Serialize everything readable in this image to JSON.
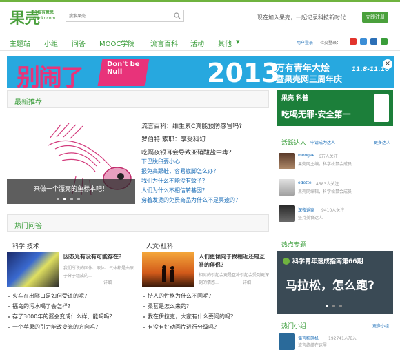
{
  "header": {
    "logo_cn": "果壳",
    "logo_small": "科技有意思",
    "logo_url": "Guokr.com",
    "search_placeholder": "搜索果壳",
    "join_text": "现在加入果壳，一起记录科技新时代",
    "join_button": "立即注册"
  },
  "nav": {
    "items": [
      "主题站",
      "小组",
      "问答",
      "MOOC学院",
      "流言百科",
      "活动",
      "其他"
    ],
    "login": "用户登录",
    "social_login": "社交登录："
  },
  "banner": {
    "big_text": "别闹了",
    "dont_be_null": "Don't be Null",
    "year": "2013",
    "line1": "万有青年大烩",
    "line2": "暨果壳网三周年庆",
    "dates": "11.8-11.10",
    "close": "×"
  },
  "latest": {
    "title": "最新推荐",
    "caption": "来做一个漂亮的鱼标本吧！",
    "headlines": [
      "流言百科：维生素C真能预防感冒吗?",
      "罗伯特·索耶：享受科幻",
      "吃隔夜银耳会导致亚硝酸盐中毒？"
    ],
    "links": [
      "下巴脱臼要小心",
      "报免高跟鞋，容易崴脚怎么办？",
      "我们为什么不能没有蚊子？",
      "人们为什么不相信转基因？",
      "穿着发烫的免费商品为什么不是冥途的？"
    ]
  },
  "hotqa": {
    "title": "热门问答",
    "science": {
      "label": "科学·技术",
      "q_title": "因态光有没有可能存在？",
      "q_desc": "我们所说的固体、液体、气体都是由原子分子组成的…",
      "detail": "详细",
      "list": [
        "火车在出隧口是如何受道的呢?",
        "福岛的污水喝了会怎样?",
        "存了3000年的酱会变成什么样、能喝吗？",
        "一个苹果的引力能改变光的方向吗？"
      ]
    },
    "humanities": {
      "label": "人文·社科",
      "q_title": "人们更倾向于找相近还是互补的伴侣？",
      "q_desc": "相似的引起会更是互补引起会受到更深刻的情感…",
      "detail": "详细",
      "list": [
        "持人的性格为什么不同呢？",
        "桑葚是怎么来的?",
        "我在伊拉克，大家有什么要问的吗？",
        "有没有好动画片进行分级吗？"
      ]
    }
  },
  "sidebar": {
    "ad_text": "吃喝无罪·安全第一",
    "ad_brand": "果壳 科普",
    "active_users_title": "活跃达人",
    "apply_link": "申请成为达人",
    "more": "更多达人",
    "users": [
      {
        "name": "moogee",
        "info": "6万人关注",
        "desc": "果壳网主编，科学松鼠会成员"
      },
      {
        "name": "odette",
        "info": "4583人关注",
        "desc": "果壳网编辑，科学松鼠会成员"
      },
      {
        "name": "深夜返家",
        "info": "9410人关注",
        "desc": "坚持美食达人"
      }
    ],
    "hot_topics_title": "热点专题",
    "hot_topic_headline": "科学青年速成指南第66期",
    "hot_topic_sub": "马拉松，怎么跑?",
    "hot_groups_title": "热门小组",
    "more_groups": "更多小组",
    "group": {
      "name": "谣言粉碎机",
      "info": "192741人加入",
      "desc": "流言终结在这里"
    }
  }
}
